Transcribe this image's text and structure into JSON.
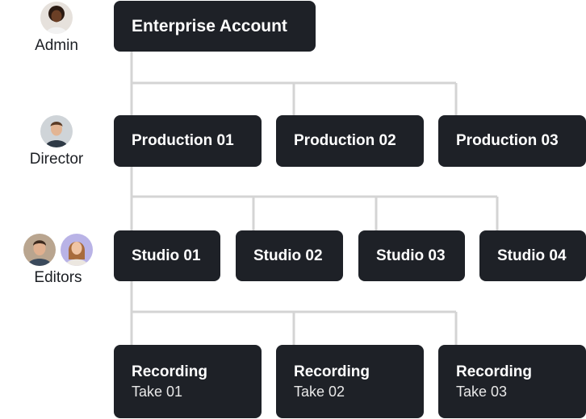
{
  "roles": {
    "admin": {
      "label": "Admin",
      "avatar_icon": "woman-avatar-icon"
    },
    "director": {
      "label": "Director",
      "avatar_icon": "man-avatar-icon"
    },
    "editors": {
      "label": "Editors",
      "avatar_icons": [
        "man-avatar-icon",
        "woman-avatar-icon"
      ]
    }
  },
  "enterprise": {
    "title": "Enterprise Account"
  },
  "productions": [
    {
      "title": "Production 01"
    },
    {
      "title": "Production 02"
    },
    {
      "title": "Production 03"
    }
  ],
  "studios": [
    {
      "title": "Studio 01"
    },
    {
      "title": "Studio 02"
    },
    {
      "title": "Studio 03"
    },
    {
      "title": "Studio 04"
    }
  ],
  "recordings": [
    {
      "title": "Recording",
      "subtitle": "Take 01"
    },
    {
      "title": "Recording",
      "subtitle": "Take 02"
    },
    {
      "title": "Recording",
      "subtitle": "Take 03"
    }
  ],
  "colors": {
    "node_background": "#1e2127",
    "node_text": "#ffffff",
    "connector": "#d4d4d4"
  }
}
